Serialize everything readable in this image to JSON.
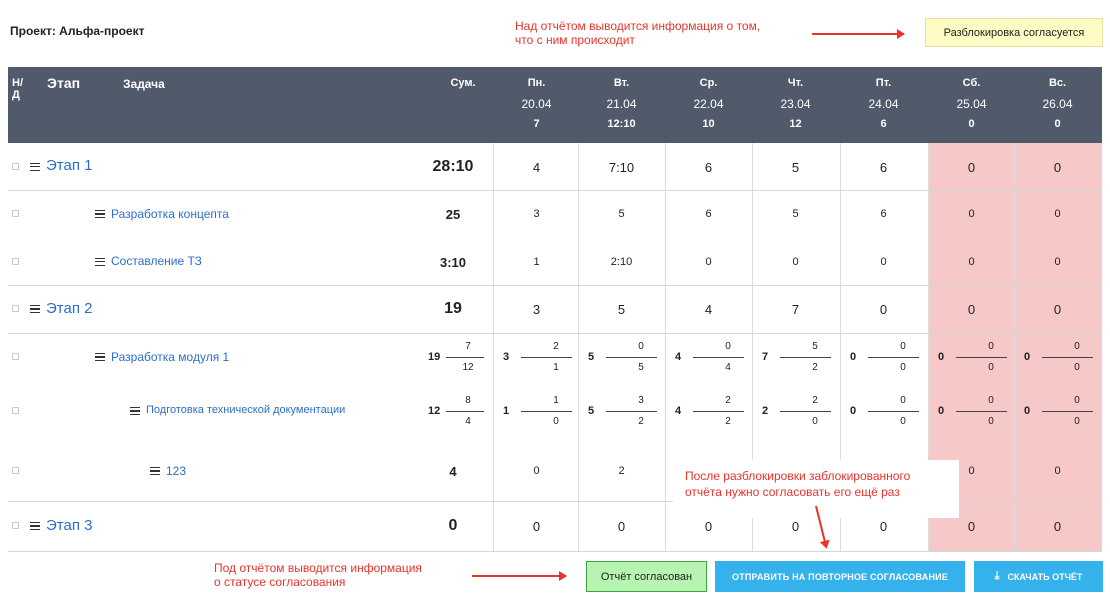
{
  "project": {
    "title": "Проект: Альфа-проект"
  },
  "annotations": {
    "top": [
      "Над отчётом выводится информация о том,",
      "что с ним происходит"
    ],
    "bottom": [
      "Под отчётом выводится информация",
      "о статусе согласования"
    ],
    "popup": [
      "После разблокировки заблокированного",
      "отчёта нужно согласовать его ещё раз"
    ]
  },
  "status_top": "Разблокировка согласуется",
  "header": {
    "nd": [
      "Н/",
      "Д"
    ],
    "stage": "Этап",
    "task": "Задача",
    "sum": "Сум.",
    "days": [
      {
        "name": "Пн.",
        "date": "20.04",
        "total": "7"
      },
      {
        "name": "Вт.",
        "date": "21.04",
        "total": "12:10"
      },
      {
        "name": "Ср.",
        "date": "22.04",
        "total": "10"
      },
      {
        "name": "Чт.",
        "date": "23.04",
        "total": "12"
      },
      {
        "name": "Пт.",
        "date": "24.04",
        "total": "6"
      },
      {
        "name": "Сб.",
        "date": "25.04",
        "total": "0"
      },
      {
        "name": "Вс.",
        "date": "26.04",
        "total": "0"
      }
    ]
  },
  "rows": {
    "stage1": {
      "name": "Этап 1",
      "sum": "28:10",
      "days": [
        "4",
        "7:10",
        "6",
        "5",
        "6",
        "0",
        "0"
      ]
    },
    "task1": {
      "name": "Разработка концепта",
      "sum": "25",
      "days": [
        "3",
        "5",
        "6",
        "5",
        "6",
        "0",
        "0"
      ]
    },
    "task2": {
      "name": "Составление ТЗ",
      "sum": "3:10",
      "days": [
        "1",
        "2:10",
        "0",
        "0",
        "0",
        "0",
        "0"
      ]
    },
    "stage2": {
      "name": "Этап 2",
      "sum": "19",
      "days": [
        "3",
        "5",
        "4",
        "7",
        "0",
        "0",
        "0"
      ]
    },
    "task3": {
      "name": "Разработка модуля 1",
      "sum": {
        "big": "19",
        "top": "7",
        "bot": "12"
      },
      "days": [
        {
          "big": "3",
          "top": "2",
          "bot": "1"
        },
        {
          "big": "5",
          "top": "0",
          "bot": "5"
        },
        {
          "big": "4",
          "top": "0",
          "bot": "4"
        },
        {
          "big": "7",
          "top": "5",
          "bot": "2"
        },
        {
          "big": "0",
          "top": "0",
          "bot": "0"
        },
        {
          "big": "0",
          "top": "0",
          "bot": "0"
        },
        {
          "big": "0",
          "top": "0",
          "bot": "0"
        }
      ]
    },
    "task4": {
      "name": "Подготовка технической документации",
      "sum": {
        "big": "12",
        "top": "8",
        "bot": "4"
      },
      "days": [
        {
          "big": "1",
          "top": "1",
          "bot": "0"
        },
        {
          "big": "5",
          "top": "3",
          "bot": "2"
        },
        {
          "big": "4",
          "top": "2",
          "bot": "2"
        },
        {
          "big": "2",
          "top": "2",
          "bot": "0"
        },
        {
          "big": "0",
          "top": "0",
          "bot": "0"
        },
        {
          "big": "0",
          "top": "0",
          "bot": "0"
        },
        {
          "big": "0",
          "top": "0",
          "bot": "0"
        }
      ]
    },
    "task5": {
      "name": "123",
      "sum": "4",
      "days": [
        "0",
        "2",
        "",
        "",
        "",
        "0",
        "0"
      ]
    },
    "stage3": {
      "name": "Этап 3",
      "sum": "0",
      "days": [
        "0",
        "0",
        "0",
        "0",
        "0",
        "0",
        "0"
      ]
    }
  },
  "buttons": {
    "status": "Отчёт согласован",
    "resend": "ОТПРАВИТЬ НА ПОВТОРНОЕ СОГЛАСОВАНИЕ",
    "download": "СКАЧАТЬ ОТЧЁТ"
  },
  "colors": {
    "header_bg": "#505a6a",
    "weekend_bg": "#f6c8c8",
    "link": "#2c6fc9",
    "annotation": "#e8332a",
    "button_blue": "#35b2ec",
    "status_green": "#b7f4b2",
    "status_yellow": "#fffbc4"
  }
}
